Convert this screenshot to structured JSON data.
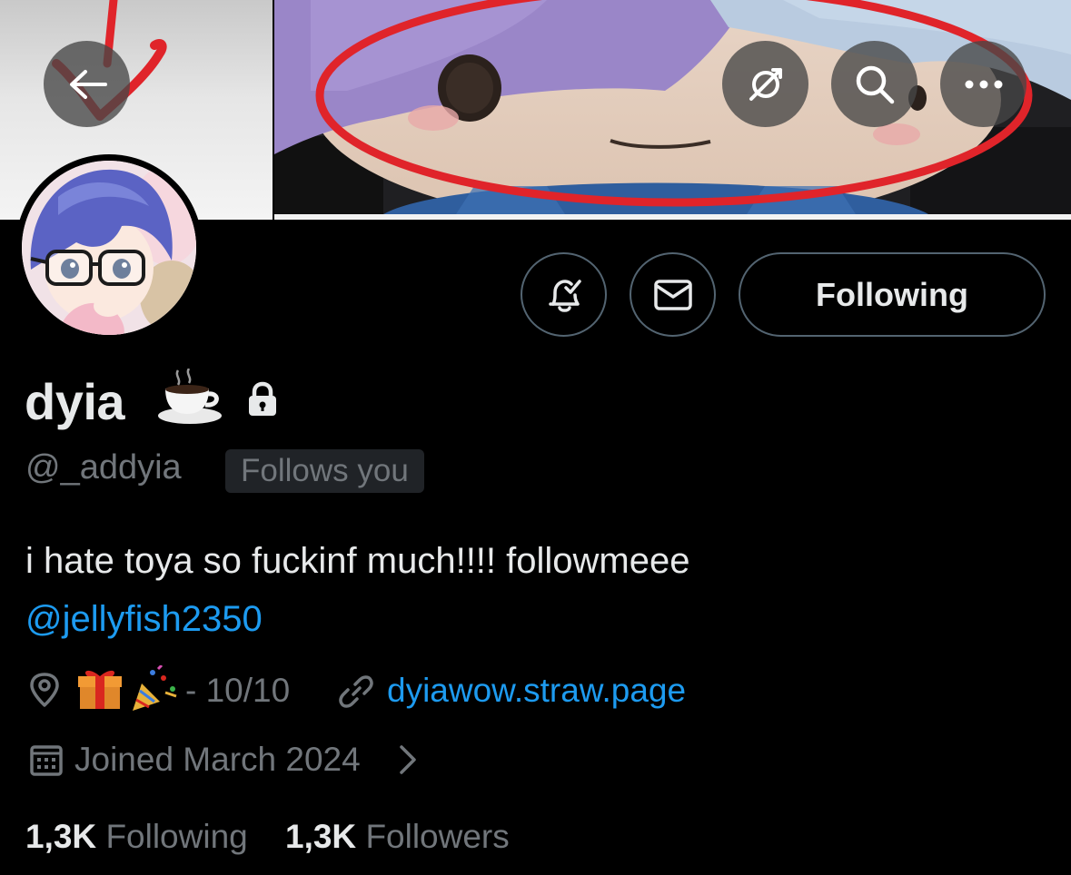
{
  "header": {
    "back_icon": "arrow-left-icon",
    "translate_icon": "translate-icon",
    "search_icon": "search-icon",
    "more_icon": "more-horizontal-icon"
  },
  "actions": {
    "notify_icon": "bell-check-icon",
    "message_icon": "envelope-icon",
    "following_label": "Following"
  },
  "profile": {
    "name": "dyia",
    "name_emoji": "☕",
    "protected_icon": "lock-icon",
    "handle": "@_addyia",
    "follows_you_label": "Follows you",
    "bio": "i hate toya so fuckinf much!!!! followmeee",
    "bio_mention": "@jellyfish2350",
    "location_emoji": "🎁🎉",
    "location_text": "- 10/10",
    "website": "dyiawow.straw.page",
    "joined": "Joined March 2024"
  },
  "stats": {
    "following_count": "1,3K",
    "following_label": "Following",
    "followers_count": "1,3K",
    "followers_label": "Followers"
  },
  "colors": {
    "background": "#000000",
    "primary_text": "#e7e9ea",
    "secondary_text": "#71767b",
    "link": "#1d9bf0",
    "border": "#536471",
    "annotation_red": "#e0242a"
  }
}
